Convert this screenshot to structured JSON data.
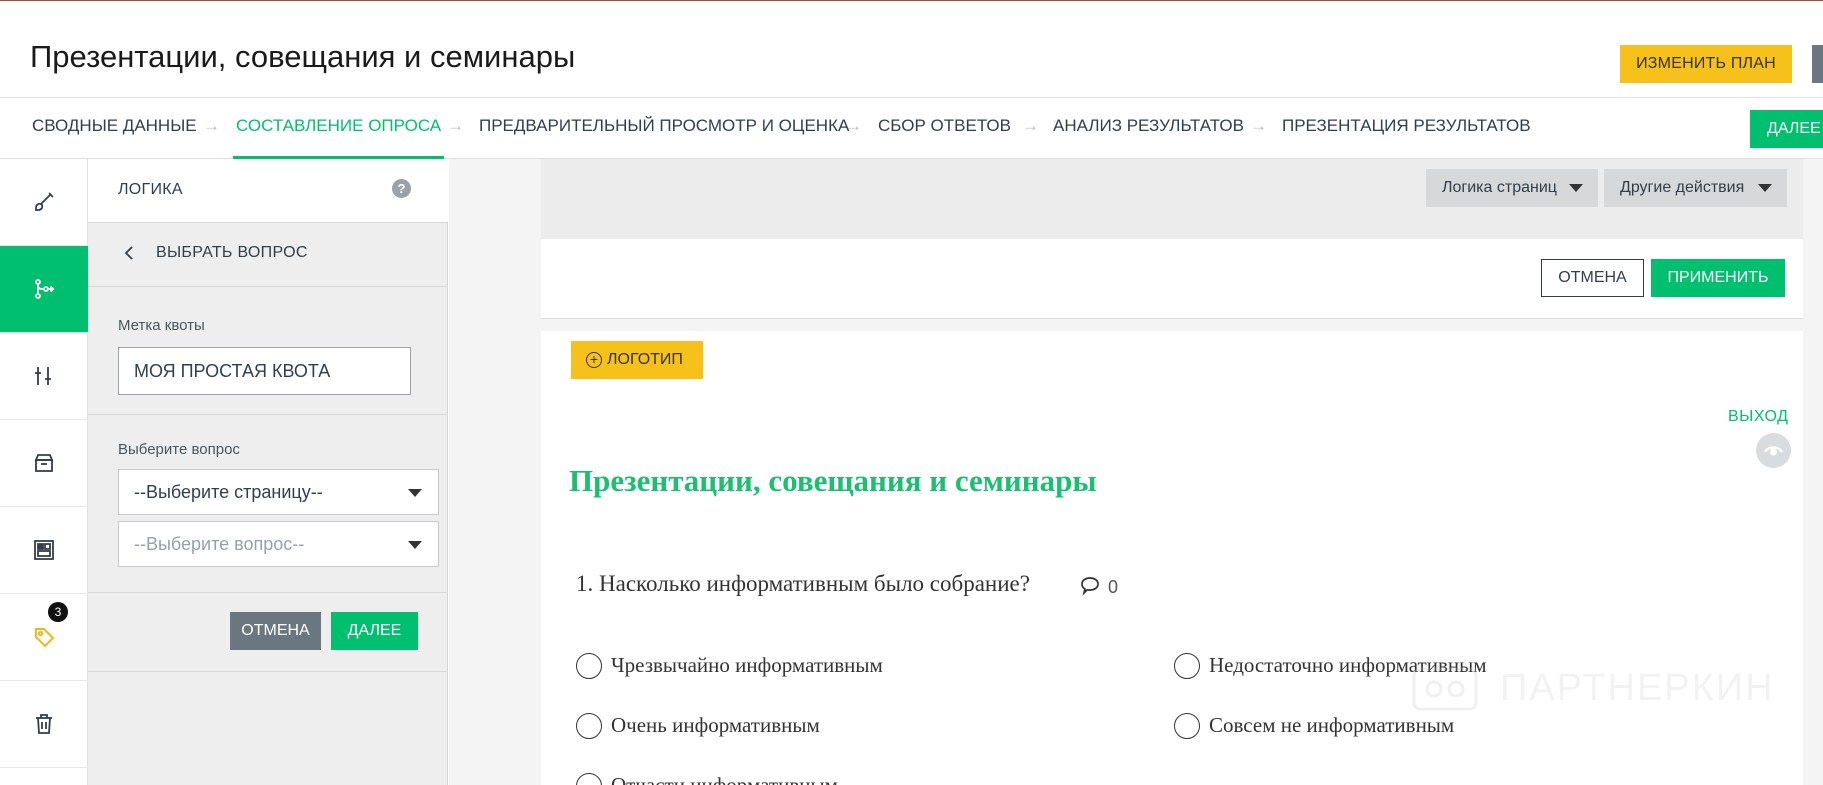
{
  "header": {
    "title": "Презентации, совещания и семинары",
    "change_plan": "ИЗМЕНИТЬ ПЛАН"
  },
  "steps": [
    {
      "label": "СВОДНЫЕ ДАННЫЕ",
      "active": false
    },
    {
      "label": "СОСТАВЛЕНИЕ ОПРОСА",
      "active": true
    },
    {
      "label": "ПРЕДВАРИТЕЛЬНЫЙ ПРОСМОТР И ОЦЕНКА",
      "active": false
    },
    {
      "label": "СБОР ОТВЕТОВ",
      "active": false
    },
    {
      "label": "АНАЛИЗ РЕЗУЛЬТАТОВ",
      "active": false
    },
    {
      "label": "ПРЕЗЕНТАЦИЯ РЕЗУЛЬТАТОВ",
      "active": false
    }
  ],
  "next_top": "ДАЛЕЕ",
  "rail": {
    "items": [
      {
        "icon": "brush-icon",
        "active": false
      },
      {
        "icon": "logic-icon",
        "active": true
      },
      {
        "icon": "options-icon",
        "active": false
      },
      {
        "icon": "bank-icon",
        "active": false
      },
      {
        "icon": "layout-icon",
        "active": false
      },
      {
        "icon": "tag-icon",
        "active": false,
        "badge": "3"
      },
      {
        "icon": "trash-icon",
        "active": false
      }
    ]
  },
  "panel": {
    "title": "ЛОГИКА",
    "help": "?",
    "back": "ВЫБРАТЬ ВОПРОС",
    "quota_label": "Метка квоты",
    "quota_value": "МОЯ ПРОСТАЯ КВОТА",
    "question_label": "Выберите вопрос",
    "page_select": "--Выберите страницу--",
    "question_select": "--Выберите вопрос--",
    "cancel": "ОТМЕНА",
    "next": "ДАЛЕЕ"
  },
  "toolbar": {
    "page_logic": "Логика страниц",
    "other_actions": "Другие действия"
  },
  "apply_bar": {
    "cancel": "ОТМЕНА",
    "apply": "ПРИМЕНИТЬ"
  },
  "survey": {
    "logo_button": "ЛОГОТИП",
    "exit": "ВЫХОД",
    "title": "Презентации, совещания и семинары",
    "question": "1. Насколько информативным было собрание?",
    "comment_count": "0",
    "options": [
      "Чрезвычайно информативным",
      "Недостаточно информативным",
      "Очень информативным",
      "Совсем не информативным",
      "Отчасти информативным"
    ]
  },
  "watermark": "ПАРТНЕРКИН",
  "colors": {
    "accent_green": "#00bf6f",
    "accent_yellow": "#f7c11b",
    "dark_grey": "#6b7780"
  }
}
